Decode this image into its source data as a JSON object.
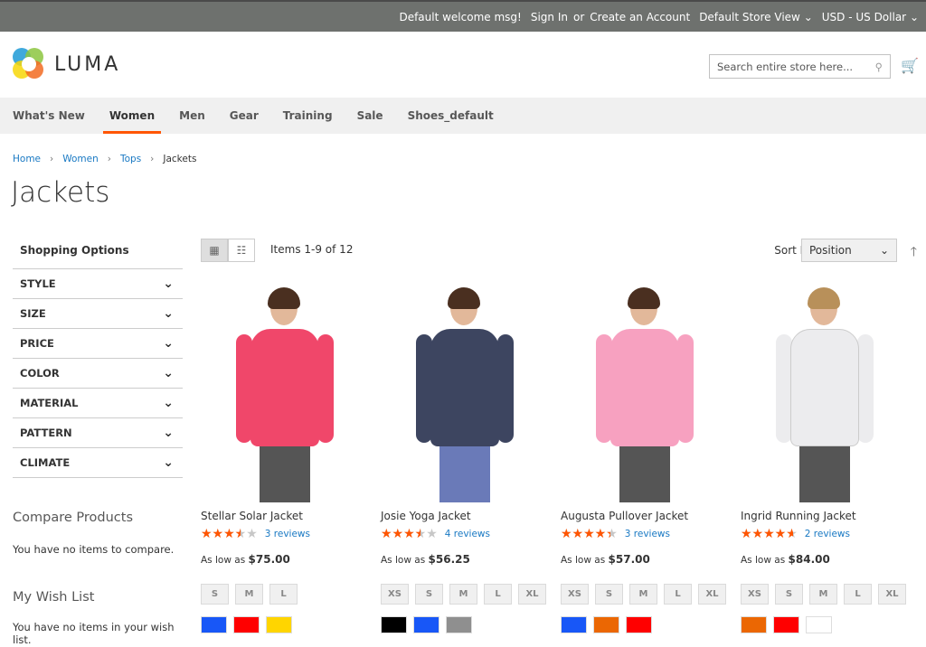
{
  "topbar": {
    "welcome": "Default welcome msg!",
    "sign_in": "Sign In",
    "or": "or",
    "create": "Create an Account",
    "store": "Default Store View",
    "currency": "USD - US Dollar"
  },
  "header": {
    "logo": "LUMA",
    "search_placeholder": "Search entire store here..."
  },
  "nav": [
    "What's New",
    "Women",
    "Men",
    "Gear",
    "Training",
    "Sale",
    "Shoes_default"
  ],
  "breadcrumb": [
    "Home",
    "Women",
    "Tops",
    "Jackets"
  ],
  "page_title": "Jackets",
  "sidebar": {
    "title": "Shopping Options",
    "filters": [
      "STYLE",
      "SIZE",
      "PRICE",
      "COLOR",
      "MATERIAL",
      "PATTERN",
      "CLIMATE"
    ],
    "compare_title": "Compare Products",
    "compare_text": "You have no items to compare.",
    "wish_title": "My Wish List",
    "wish_text": "You have no items in your wish list."
  },
  "toolbar": {
    "items": "Items 1-9 of 12",
    "sort_label": "Sort By",
    "sort_value": "Position"
  },
  "products": [
    {
      "name": "Stellar Solar Jacket",
      "rating_pct": 70,
      "reviews": "3 reviews",
      "price_label": "As low as",
      "price": "$75.00",
      "sizes": [
        "S",
        "M",
        "L"
      ],
      "colors": [
        "#1857f7",
        "#ff0000",
        "#ffd500"
      ],
      "jacket": "#f0476a"
    },
    {
      "name": "Josie Yoga Jacket",
      "rating_pct": 70,
      "reviews": "4 reviews",
      "price_label": "As low as",
      "price": "$56.25",
      "sizes": [
        "XS",
        "S",
        "M",
        "L",
        "XL"
      ],
      "colors": [
        "#000000",
        "#1857f7",
        "#8f8f8f"
      ],
      "jacket": "#3d4560"
    },
    {
      "name": "Augusta Pullover Jacket",
      "rating_pct": 87,
      "reviews": "3 reviews",
      "price_label": "As low as",
      "price": "$57.00",
      "sizes": [
        "XS",
        "S",
        "M",
        "L",
        "XL"
      ],
      "colors": [
        "#1857f7",
        "#eb6703",
        "#ff0000"
      ],
      "jacket": "#f7a1c0"
    },
    {
      "name": "Ingrid Running Jacket",
      "rating_pct": 93,
      "reviews": "2 reviews",
      "price_label": "As low as",
      "price": "$84.00",
      "sizes": [
        "XS",
        "S",
        "M",
        "L",
        "XL"
      ],
      "colors": [
        "#eb6703",
        "#ff0000",
        "#ffffff"
      ],
      "jacket": "#ececee"
    }
  ]
}
